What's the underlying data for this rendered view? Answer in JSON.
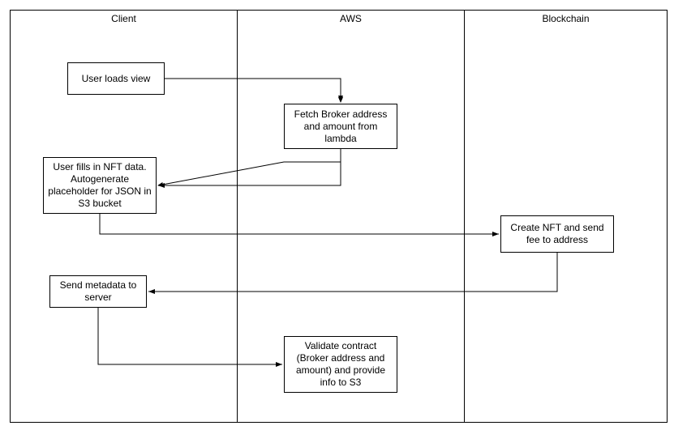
{
  "lanes": {
    "client": "Client",
    "aws": "AWS",
    "blockchain": "Blockchain"
  },
  "nodes": {
    "load_view": "User loads view",
    "fetch_broker": "Fetch Broker address and amount from lambda",
    "fill_nft": "User fills in NFT data.  Autogenerate placeholder for JSON in S3 bucket",
    "create_nft": "Create NFT and send fee to address",
    "send_metadata": "Send metadata to server",
    "validate": "Validate contract (Broker address and amount) and provide info to S3"
  }
}
